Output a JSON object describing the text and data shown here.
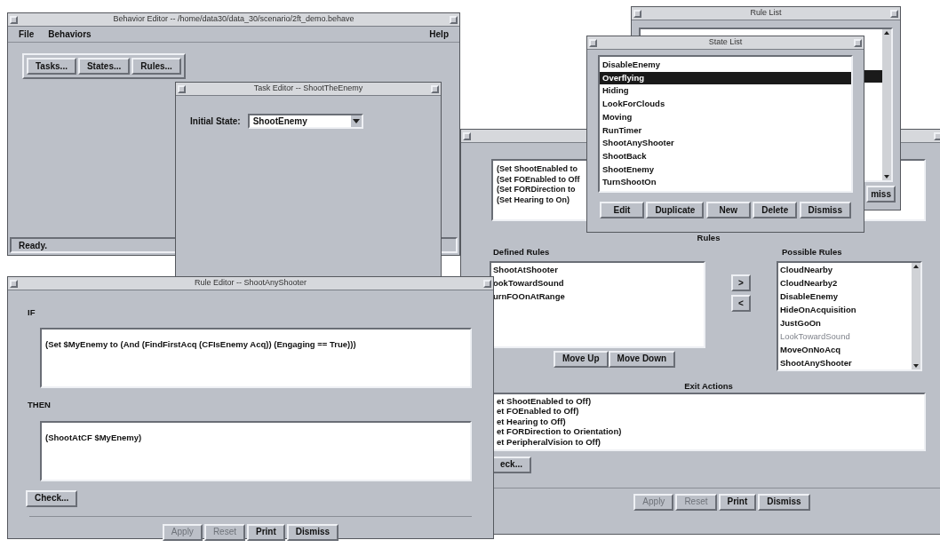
{
  "behavior_editor": {
    "title": "Behavior Editor -- /home/data30/data_30/scenario/2ft_demo.behave",
    "menus": [
      "File",
      "Behaviors"
    ],
    "help_menu": "Help",
    "toolbar": [
      "Tasks...",
      "States...",
      "Rules..."
    ],
    "status": "Ready."
  },
  "task_editor": {
    "title": "Task Editor -- ShootTheEnemy",
    "initial_state_label": "Initial State:",
    "initial_state_value": "ShootEnemy"
  },
  "state_editor": {
    "entry_actions": [
      "(Set ShootEnabled to",
      "(Set FOEnabled to Off",
      "(Set FORDirection to",
      "(Set Hearing to On)"
    ],
    "rules_heading": "Rules",
    "defined_rules_label": "Defined Rules",
    "defined_rules": [
      "ShootAtShooter",
      "ookTowardSound",
      "urnFOOnAtRange"
    ],
    "add_button": ">",
    "remove_button": "<",
    "move_buttons": [
      "Move Up",
      "Move Down"
    ],
    "possible_rules_label": "Possible Rules",
    "possible_rules": [
      {
        "name": "CloudNearby",
        "disabled": false
      },
      {
        "name": "CloudNearby2",
        "disabled": false
      },
      {
        "name": "DisableEnemy",
        "disabled": false
      },
      {
        "name": "HideOnAcquisition",
        "disabled": false
      },
      {
        "name": "JustGoOn",
        "disabled": false
      },
      {
        "name": "LookTowardSound",
        "disabled": true
      },
      {
        "name": "MoveOnNoAcq",
        "disabled": false
      },
      {
        "name": "ShootAnyShooter",
        "disabled": false
      }
    ],
    "exit_actions_heading": "Exit Actions",
    "exit_actions": [
      "et ShootEnabled to Off)",
      "et FOEnabled to Off)",
      "et Hearing to Off)",
      "et FORDirection to Orientation)",
      "et PeripheralVision to Off)"
    ],
    "check_button": "eck...",
    "buttons": [
      {
        "label": "Apply",
        "disabled": true
      },
      {
        "label": "Reset",
        "disabled": true
      },
      {
        "label": "Print",
        "disabled": false
      },
      {
        "label": "Dismiss",
        "disabled": false
      }
    ]
  },
  "rule_list": {
    "title": "Rule List",
    "dismiss_button": "miss"
  },
  "state_list": {
    "title": "State List",
    "items": [
      {
        "name": "DisableEnemy",
        "selected": false
      },
      {
        "name": "Overflying",
        "selected": true
      },
      {
        "name": "Hiding",
        "selected": false
      },
      {
        "name": "LookForClouds",
        "selected": false
      },
      {
        "name": "Moving",
        "selected": false
      },
      {
        "name": "RunTimer",
        "selected": false
      },
      {
        "name": "ShootAnyShooter",
        "selected": false
      },
      {
        "name": "ShootBack",
        "selected": false
      },
      {
        "name": "ShootEnemy",
        "selected": false
      },
      {
        "name": "TurnShootOn",
        "selected": false
      }
    ],
    "buttons": [
      "Edit",
      "Duplicate",
      "New",
      "Delete",
      "Dismiss"
    ]
  },
  "rule_editor": {
    "title": "Rule Editor -- ShootAnyShooter",
    "if_label": "IF",
    "if_text": "(Set $MyEnemy to (And (FindFirstAcq (CFIsEnemy Acq)) (Engaging == True)))",
    "then_label": "THEN",
    "then_text": "(ShootAtCF $MyEnemy)",
    "check_button": "Check...",
    "buttons": [
      {
        "label": "Apply",
        "disabled": true
      },
      {
        "label": "Reset",
        "disabled": true
      },
      {
        "label": "Print",
        "disabled": false
      },
      {
        "label": "Dismiss",
        "disabled": false
      }
    ]
  }
}
